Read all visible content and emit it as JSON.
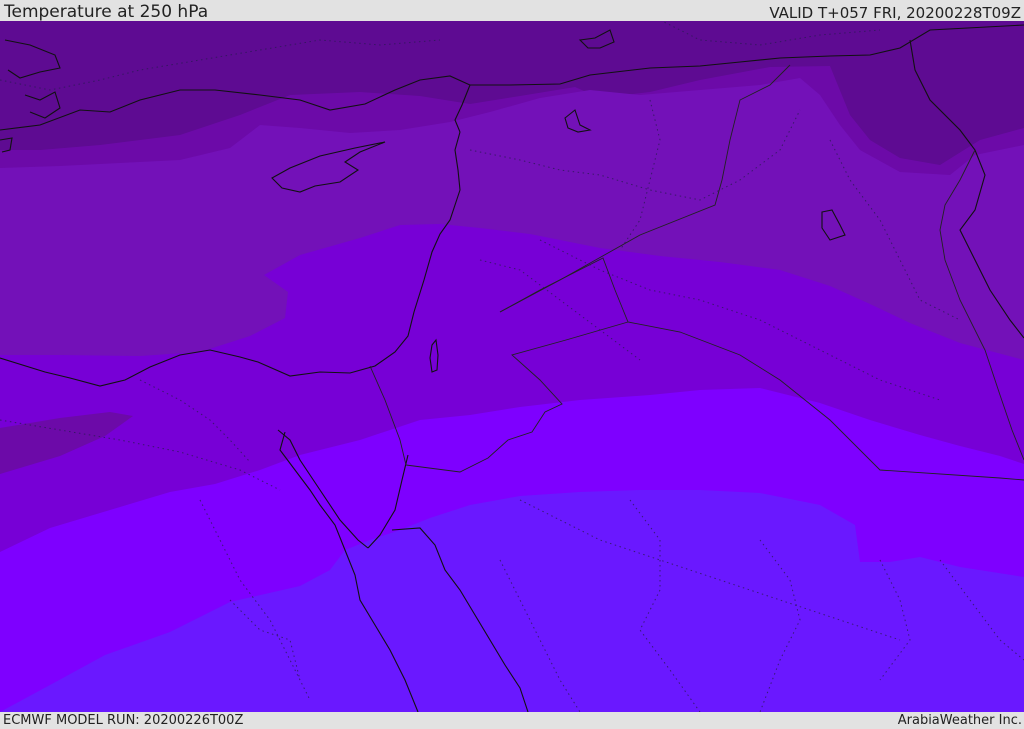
{
  "header": {
    "title": "Temperature at 250 hPa",
    "valid_time": "VALID T+057 FRI, 20200228T09Z"
  },
  "footer": {
    "model_run": "ECMWF MODEL RUN: 20200226T00Z",
    "credit": "ArabiaWeather Inc."
  },
  "map": {
    "variable": "temperature",
    "pressure_level_hpa": 250,
    "colors": {
      "band_coldest": "#5e0b92",
      "band_2": "#6c0aa8",
      "band_3": "#7311b8",
      "band_4": "#7700d6",
      "band_5": "#7e00ff",
      "band_warmest": "#6a18ff",
      "coastline": "#111111",
      "border": "#222222"
    }
  }
}
